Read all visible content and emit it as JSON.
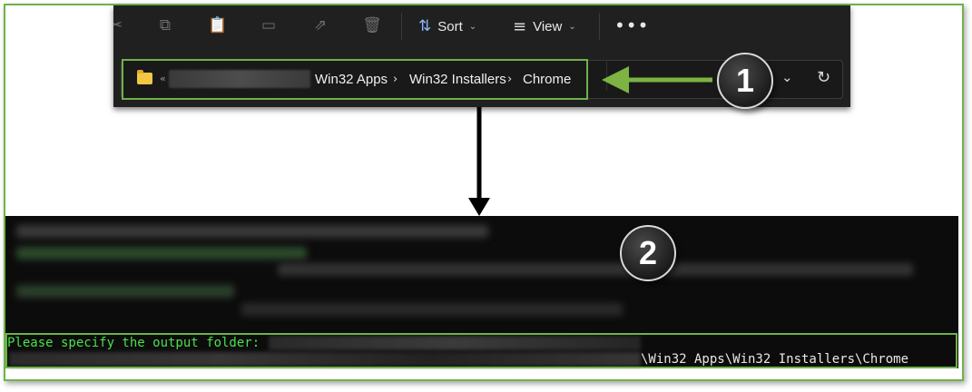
{
  "toolbar": {
    "sort_label": "Sort",
    "view_label": "View",
    "more_label": "•••",
    "chevron": "⌄"
  },
  "address_bar": {
    "overflow": "«",
    "breadcrumbs": [
      "Win32 Apps",
      "Win32 Installers",
      "Chrome"
    ],
    "separator": "›"
  },
  "callouts": [
    "1",
    "2"
  ],
  "console": {
    "prompt": "Please specify the output folder:",
    "path_suffix": "\\Win32 Apps\\Win32 Installers\\Chrome"
  },
  "colors": {
    "highlight": "#6fb24a",
    "console_text": "#4ce04c",
    "explorer_bg": "#202020"
  }
}
